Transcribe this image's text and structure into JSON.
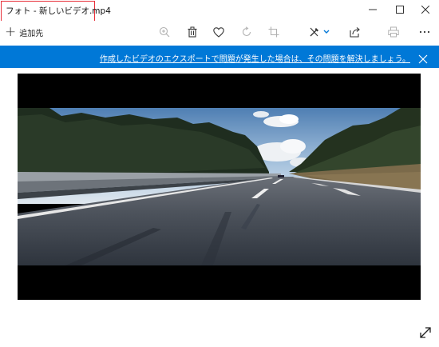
{
  "window": {
    "title": "フォト - 新しいビデオ.mp4",
    "controls": [
      "minimize-icon",
      "maximize-icon",
      "close-icon"
    ]
  },
  "toolbar": {
    "add_label": "追加先",
    "icons": [
      "zoom-in-icon",
      "delete-icon",
      "favorite-heart-icon",
      "rotate-icon",
      "crop-icon",
      "edit-create-icon",
      "share-icon",
      "print-icon",
      "more-icon"
    ]
  },
  "banner": {
    "message": "作成したビデオのエクスポートで問題が発生した場合は、その問題を解決しましょう。",
    "background": "#0078d7"
  },
  "media": {
    "content": "video-frame-highway-forest"
  },
  "colors": {
    "accent": "#0078d7",
    "highlight_border": "#e8303a"
  }
}
